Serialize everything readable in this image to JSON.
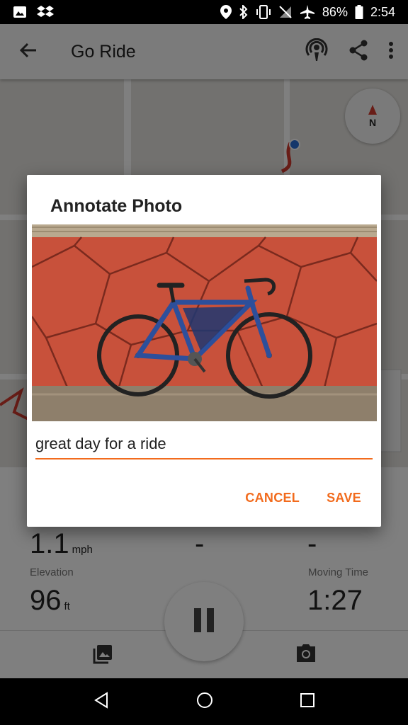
{
  "status_bar": {
    "battery": "86%",
    "time": "2:54"
  },
  "app_bar": {
    "title": "Go Ride"
  },
  "stats": {
    "speed": {
      "value": "1.1",
      "unit": "mph"
    },
    "col2_value": "-",
    "col3_value": "-",
    "elevation": {
      "label": "Elevation",
      "value": "96",
      "unit": "ft"
    },
    "moving_time": {
      "label": "Moving Time",
      "value": "1:27"
    }
  },
  "dialog": {
    "title": "Annotate Photo",
    "caption_value": "great day for a ride",
    "cancel_label": "CANCEL",
    "save_label": "SAVE"
  },
  "compass": {
    "label": "N"
  },
  "colors": {
    "accent": "#f26b1d",
    "wall": "#c8513b",
    "bike_frame": "#2d4f9b"
  }
}
